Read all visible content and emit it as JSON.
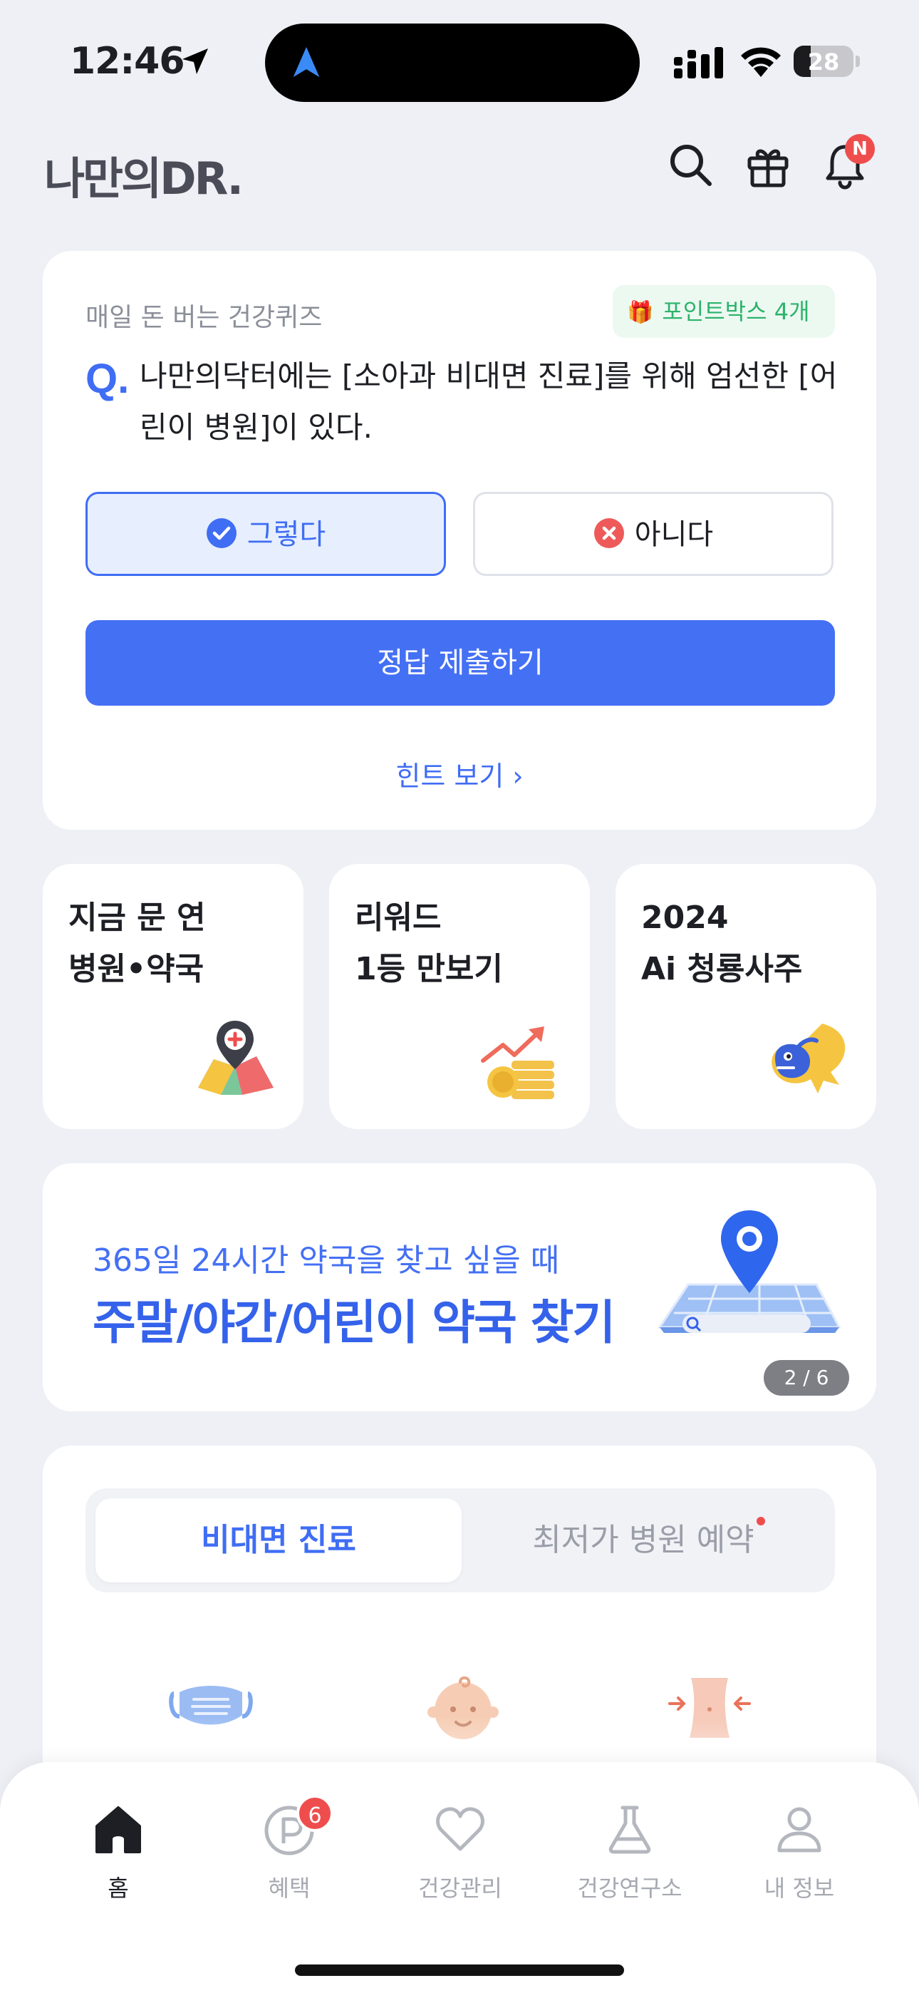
{
  "status": {
    "time": "12:46",
    "battery": "28",
    "battery_fraction": 0.28
  },
  "header": {
    "logo": "나만의DR.",
    "notification_badge": "N",
    "icons": [
      "search-icon",
      "gift-icon",
      "bell-icon"
    ]
  },
  "quiz": {
    "title": "매일 돈 버는 건강퀴즈",
    "pointbox": "포인트박스 4개",
    "q_marker": "Q.",
    "question": "나만의닥터에는 [소아과 비대면 진료]를 위해 엄선한 [어린이 병원]이 있다.",
    "answer_yes": "그렇다",
    "answer_no": "아니다",
    "submit": "정답 제출하기",
    "hint": "힌트 보기 ›"
  },
  "tiles": [
    {
      "label": "지금 문 연\n병원•약국",
      "icon": "map-pin-icon"
    },
    {
      "label": "리워드\n1등 만보기",
      "icon": "coin-chart-icon"
    },
    {
      "label": "2024\nAi 청룡사주",
      "icon": "dragon-icon"
    }
  ],
  "banner": {
    "subtitle": "365일 24시간 약국을 찾고 싶을 때",
    "title": "주말/야간/어린이 약국 찾기",
    "pager": "2 / 6"
  },
  "care": {
    "tab_active": "비대면 진료",
    "tab_inactive": "최저가 병원 예약",
    "icons": [
      "mask-icon",
      "baby-icon",
      "waist-icon"
    ]
  },
  "tabbar": {
    "items": [
      {
        "label": "홈",
        "icon": "home-icon",
        "active": true
      },
      {
        "label": "혜택",
        "icon": "point-icon",
        "badge": "6"
      },
      {
        "label": "건강관리",
        "icon": "heart-icon"
      },
      {
        "label": "건강연구소",
        "icon": "flask-icon"
      },
      {
        "label": "내 정보",
        "icon": "person-icon"
      }
    ]
  },
  "colors": {
    "accent": "#4470f4",
    "background": "#eef0f5",
    "badge": "#ef4d4d",
    "pointbox": "#2db36b"
  }
}
